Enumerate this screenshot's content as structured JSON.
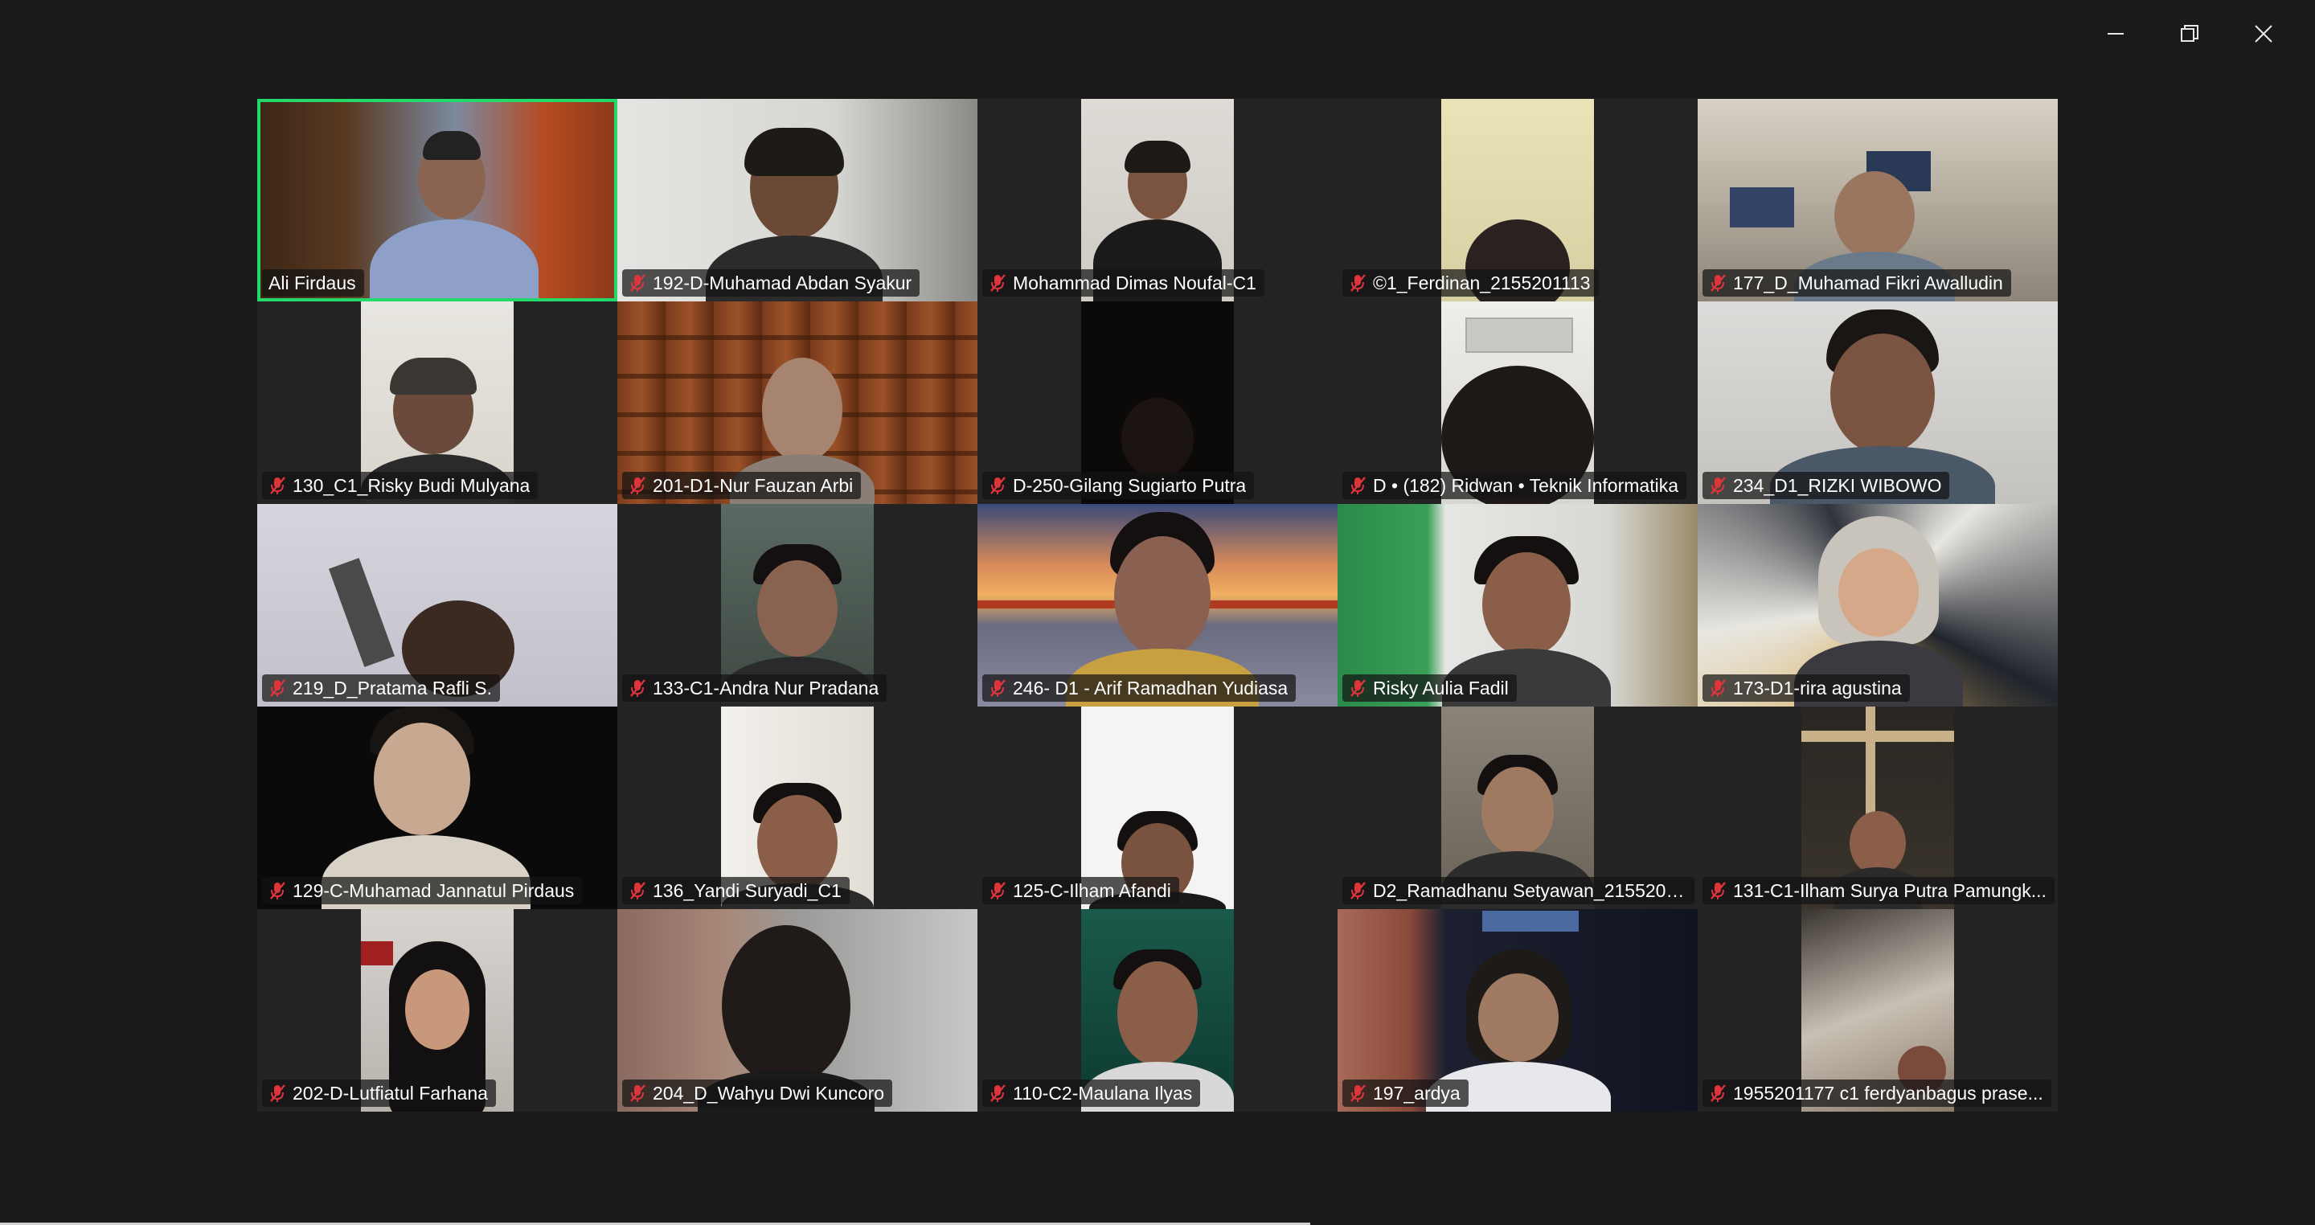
{
  "window": {
    "controls": [
      "minimize-icon",
      "restore-icon",
      "close-icon"
    ]
  },
  "colors": {
    "active_speaker": "#23d96a",
    "mute": "#e0343b"
  },
  "participants": [
    {
      "name": "Ali Firdaus",
      "muted": false,
      "active": true
    },
    {
      "name": "192-D-Muhamad Abdan Syakur",
      "muted": true
    },
    {
      "name": "Mohammad Dimas Noufal-C1",
      "muted": true
    },
    {
      "name": "©1_Ferdinan_2155201113",
      "muted": true
    },
    {
      "name": "177_D_Muhamad Fikri Awalludin",
      "muted": true
    },
    {
      "name": "130_C1_Risky Budi Mulyana",
      "muted": true
    },
    {
      "name": "201-D1-Nur Fauzan Arbi",
      "muted": true
    },
    {
      "name": "D-250-Gilang Sugiarto Putra",
      "muted": true
    },
    {
      "name": "D • (182) Ridwan • Teknik Informatika",
      "muted": true
    },
    {
      "name": "234_D1_RIZKI WIBOWO",
      "muted": true
    },
    {
      "name": "219_D_Pratama Rafli S.",
      "muted": true
    },
    {
      "name": "133-C1-Andra Nur Pradana",
      "muted": true
    },
    {
      "name": "246- D1 - Arif Ramadhan Yudiasa",
      "muted": true
    },
    {
      "name": "Risky Aulia Fadil",
      "muted": true
    },
    {
      "name": "173-D1-rira agustina",
      "muted": true
    },
    {
      "name": "129-C-Muhamad Jannatul Pirdaus",
      "muted": true
    },
    {
      "name": "136_Yandi Suryadi_C1",
      "muted": true
    },
    {
      "name": "125-C-Ilham Afandi",
      "muted": true
    },
    {
      "name": "D2_Ramadhanu Setyawan_2155201...",
      "muted": true
    },
    {
      "name": "131-C1-Ilham Surya Putra Pamungk...",
      "muted": true
    },
    {
      "name": "202-D-Lutfiatul Farhana",
      "muted": true
    },
    {
      "name": "204_D_Wahyu Dwi Kuncoro",
      "muted": true
    },
    {
      "name": "110-C2-Maulana Ilyas",
      "muted": true
    },
    {
      "name": "197_ardya",
      "muted": true
    },
    {
      "name": "1955201177 c1 ferdyanbagus prase...",
      "muted": true
    }
  ]
}
